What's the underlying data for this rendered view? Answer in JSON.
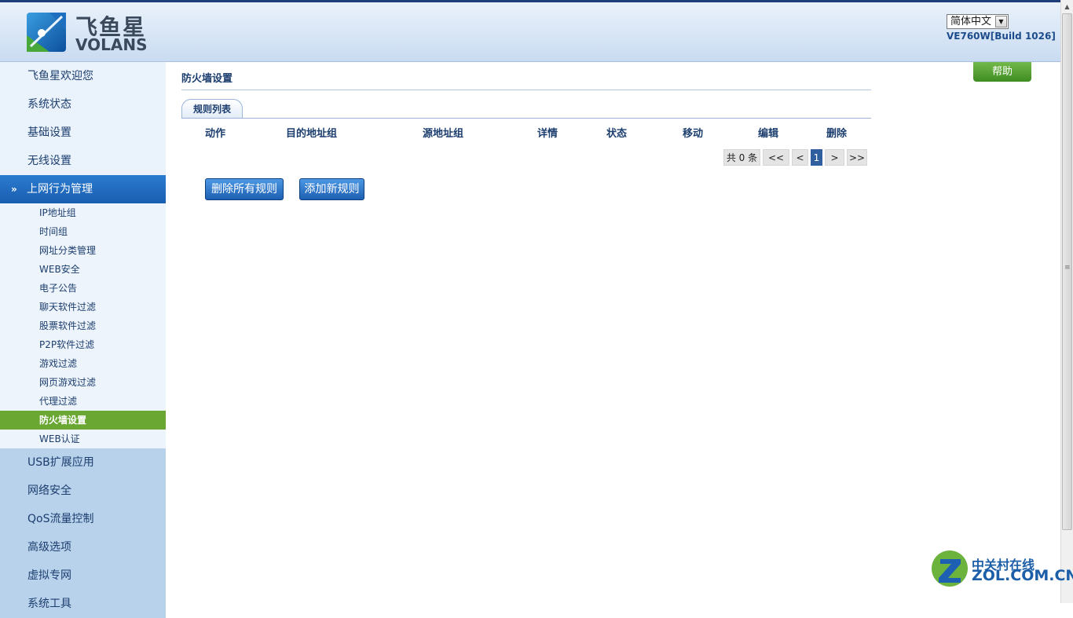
{
  "header": {
    "brand_cn": "飞鱼星",
    "brand_en": "VOLANS",
    "language_selected": "简体中文",
    "version": "VE760W[Build 1026]"
  },
  "sidebar": {
    "top_items": [
      {
        "label": "飞鱼星欢迎您"
      },
      {
        "label": "系统状态"
      },
      {
        "label": "基础设置"
      },
      {
        "label": "无线设置"
      }
    ],
    "active_section": {
      "label": "上网行为管理",
      "icon": "double-chevron-down-icon"
    },
    "sub_items": [
      {
        "label": "IP地址组"
      },
      {
        "label": "时间组"
      },
      {
        "label": "网址分类管理"
      },
      {
        "label": "WEB安全"
      },
      {
        "label": "电子公告"
      },
      {
        "label": "聊天软件过滤"
      },
      {
        "label": "股票软件过滤"
      },
      {
        "label": "P2P软件过滤"
      },
      {
        "label": "游戏过滤"
      },
      {
        "label": "网页游戏过滤"
      },
      {
        "label": "代理过滤"
      },
      {
        "label": "防火墙设置",
        "active": true
      },
      {
        "label": "WEB认证"
      }
    ],
    "bottom_items": [
      {
        "label": "USB扩展应用"
      },
      {
        "label": "网络安全"
      },
      {
        "label": "QoS流量控制"
      },
      {
        "label": "高级选项"
      },
      {
        "label": "虚拟专网"
      },
      {
        "label": "系统工具"
      }
    ]
  },
  "main": {
    "page_title": "防火墙设置",
    "tab_label": "规则列表",
    "columns": [
      "动作",
      "目的地址组",
      "源地址组",
      "详情",
      "状态",
      "移动",
      "编辑",
      "删除"
    ],
    "rows": [],
    "pager": {
      "total_text": "共 0 条",
      "first": "<<",
      "prev": "<",
      "current_page": "1",
      "next": ">",
      "last": ">>"
    },
    "buttons": {
      "delete_all": "删除所有规则",
      "add_new": "添加新规则"
    }
  },
  "help_button": "帮助",
  "watermark": {
    "cn": "中关村在线",
    "en": "ZOL.COM.CN"
  },
  "colors": {
    "header_bg": "#c9dbf1",
    "active_section_bg": "#1a5db0",
    "active_subitem_bg": "#6aa632",
    "primary_button": "#1d5fb2",
    "help_button": "#3d8c22",
    "heading_text": "#1c3e6e"
  }
}
